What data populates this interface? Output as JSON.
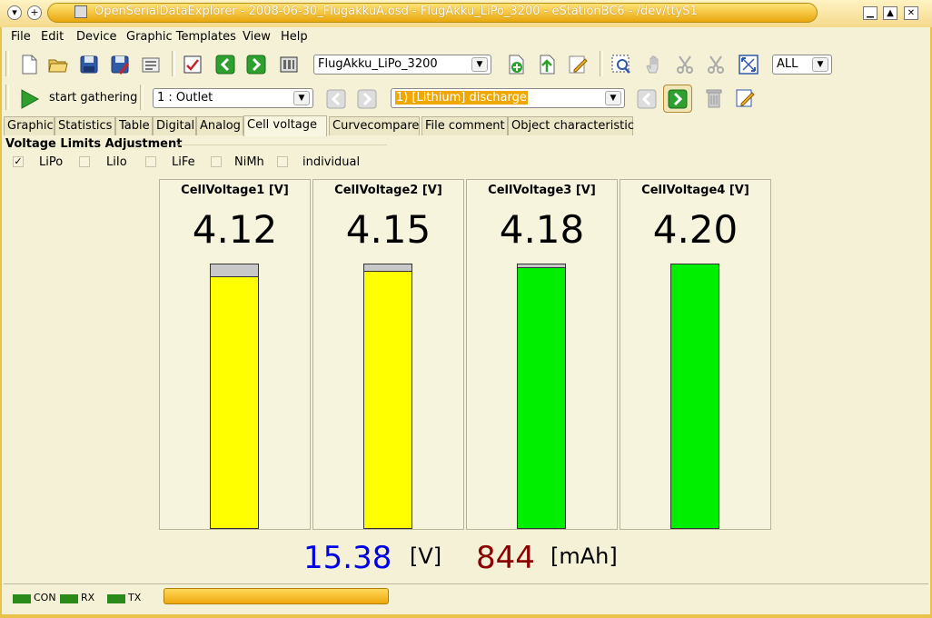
{
  "window": {
    "title": "OpenSerialDataExplorer  -  2008-06-30_FlugakkuA.osd  -  FlugAkku_LiPo_3200  -  eStationBC6  -  /dev/ttyS1"
  },
  "menu": [
    "File",
    "Edit",
    "Device",
    "Graphic Templates",
    "View",
    "Help"
  ],
  "toolbar": {
    "config_combo": "FlugAkku_LiPo_3200",
    "zoom_combo": "ALL"
  },
  "toolbar2": {
    "start_label": "start gathering",
    "outlet_combo": "1 : Outlet",
    "record_combo": "1) [Lithium] discharge"
  },
  "tabs": [
    "Graphic",
    "Statistics",
    "Table",
    "Digital",
    "Analog",
    "Cell voltage",
    "Curvecompare",
    "File comment",
    "Object characteristic"
  ],
  "active_tab": "Cell voltage",
  "voltage_limits": {
    "title": "Voltage Limits Adjustment",
    "options": [
      {
        "label": "LiPo",
        "checked": true
      },
      {
        "label": "LiIo",
        "checked": false
      },
      {
        "label": "LiFe",
        "checked": false
      },
      {
        "label": "NiMh",
        "checked": false
      },
      {
        "label": "individual",
        "checked": false
      }
    ]
  },
  "cells": [
    {
      "label": "CellVoltage1 [V]",
      "value": "4.12",
      "fill_fraction": 0.955,
      "color": "#ffff00"
    },
    {
      "label": "CellVoltage2 [V]",
      "value": "4.15",
      "fill_fraction": 0.975,
      "color": "#ffff00"
    },
    {
      "label": "CellVoltage3 [V]",
      "value": "4.18",
      "fill_fraction": 0.99,
      "color": "#00ee00"
    },
    {
      "label": "CellVoltage4 [V]",
      "value": "4.20",
      "fill_fraction": 1.0,
      "color": "#00ee00"
    }
  ],
  "totals": {
    "voltage": "15.38",
    "voltage_unit": "[V]",
    "voltage_color": "#0000e6",
    "capacity": "844",
    "capacity_unit": "[mAh]",
    "capacity_color": "#8b0000"
  },
  "status": {
    "leds": [
      "CON",
      "RX",
      "TX"
    ],
    "led_color": "#2a8a1a"
  }
}
